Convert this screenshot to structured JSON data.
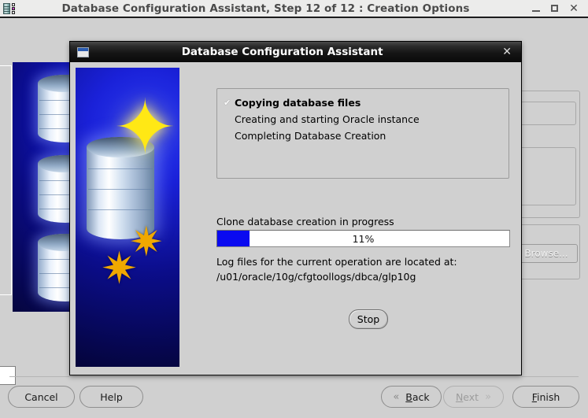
{
  "main_window": {
    "title": "Database Configuration Assistant, Step 12 of 12 : Creation Options",
    "icon": "database-app-icon",
    "controls": {
      "minimize": "–",
      "maximize": "□",
      "close": "✕"
    },
    "background": {
      "browse_button": "Browse...",
      "banner_alt": "oracle-database-banner"
    },
    "buttons": {
      "cancel": "Cancel",
      "help": "Help",
      "back": "Back",
      "back_mnemonic": "B",
      "back_icon": "chevron-left-double",
      "next": "Next",
      "next_mnemonic": "N",
      "next_icon": "chevron-right-double",
      "next_disabled": true,
      "finish": "Finish",
      "finish_mnemonic": "F"
    }
  },
  "dialog": {
    "title": "Database Configuration Assistant",
    "icon": "window-icon",
    "close_label": "✕",
    "banner_alt": "database-star-gears-graphic",
    "tasks": [
      {
        "label": "Copying database files",
        "done": true,
        "check": "✔"
      },
      {
        "label": "Creating and starting Oracle instance",
        "done": false,
        "check": ""
      },
      {
        "label": "Completing Database Creation",
        "done": false,
        "check": ""
      }
    ],
    "progress": {
      "caption": "Clone database creation in progress",
      "percent_label": "11%",
      "percent_value": 11
    },
    "log": {
      "line1": "Log files for the current operation are located at:",
      "line2": "/u01/oracle/10g/cfgtoollogs/dbca/glp10g"
    },
    "stop_button": "Stop"
  },
  "colors": {
    "window_chrome": "#d0d0d0",
    "titlebar_main": "#ececeb",
    "titlebar_dialog": "#141414",
    "progress_fill": "#0a0af0",
    "banner_blue": "#1a21d8",
    "accent_star": "#ffe815",
    "accent_gear": "#f0a800"
  }
}
